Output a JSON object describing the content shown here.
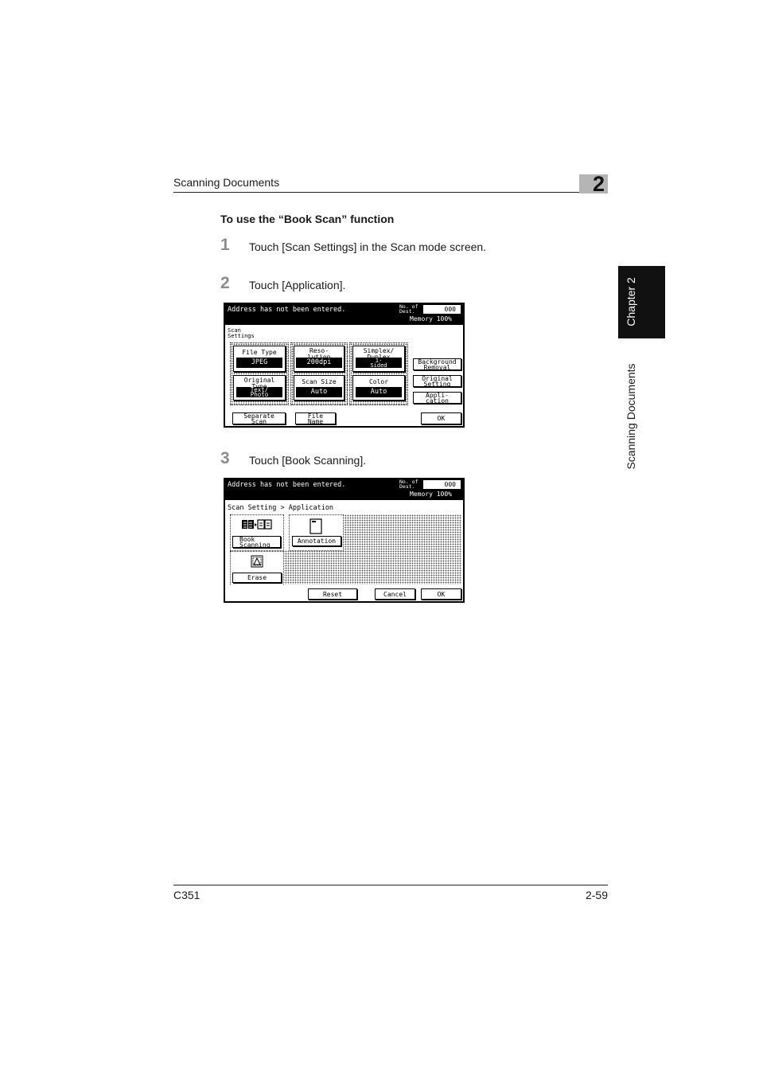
{
  "header": {
    "section_title": "Scanning Documents",
    "chapter_number": "2"
  },
  "side_tab": {
    "chapter": "Chapter 2",
    "section": "Scanning Documents"
  },
  "heading": "To use the “Book Scan” function",
  "steps": [
    {
      "num": "1",
      "text": "Touch [Scan Settings] in the Scan mode screen."
    },
    {
      "num": "2",
      "text": "Touch [Application]."
    },
    {
      "num": "3",
      "text": "Touch [Book Scanning]."
    }
  ],
  "screen1": {
    "message": "Address has not been entered.",
    "dest_label": "No. of Dest.",
    "dest_value": "000",
    "memory": "Memory 100%",
    "title": [
      "Scan",
      "Settings"
    ],
    "buttons": [
      {
        "label": [
          "File Type"
        ],
        "value": [
          "JPEG"
        ]
      },
      {
        "label": [
          "Reso-",
          "lution"
        ],
        "value": [
          "200dpi"
        ]
      },
      {
        "label": [
          "Simplex/",
          "Duplex"
        ],
        "value": [
          "1-",
          "Sided"
        ]
      },
      {
        "label": [
          "Original",
          "Type"
        ],
        "value": [
          "Text/",
          "Photo"
        ]
      },
      {
        "label": [
          "Scan Size"
        ],
        "value": [
          "Auto"
        ]
      },
      {
        "label": [
          "Color"
        ],
        "value": [
          "Auto"
        ]
      }
    ],
    "side_buttons": [
      [
        "Background",
        "Removal"
      ],
      [
        "Original",
        "Setting"
      ],
      [
        "Appli-",
        "cation"
      ]
    ],
    "bottom": {
      "separate": [
        "Separate",
        "Scan"
      ],
      "file_name": [
        "File",
        "Name"
      ],
      "ok": "OK"
    }
  },
  "screen2": {
    "message": "Address has not been entered.",
    "dest_label": "No. of Dest.",
    "dest_value": "000",
    "memory": "Memory 100%",
    "breadcrumb": "Scan Setting > Application",
    "book_scanning": [
      "Book",
      "Scanning"
    ],
    "annotation": "Annotation",
    "erase": "Erase",
    "reset": "Reset",
    "cancel": "Cancel",
    "ok": "OK"
  },
  "footer": {
    "model": "C351",
    "page": "2-59"
  }
}
